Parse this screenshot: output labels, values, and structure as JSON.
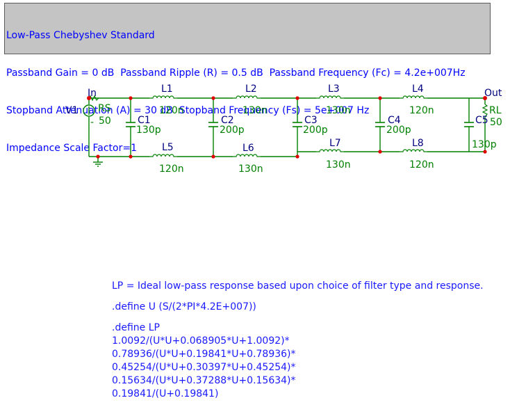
{
  "header": {
    "line1": "Low-Pass Chebyshev Standard",
    "line2": "Passband Gain = 0 dB  Passband Ripple (R) = 0.5 dB  Passband Frequency (Fc) = 4.2e+007Hz",
    "line3": "Stopband Attenuation (A) = 30 dB  Stopband Frequency (Fs) = 5e+007 Hz",
    "line4": "Impedance Scale Factor=1"
  },
  "colors": {
    "wire": "#008000",
    "component": "#008000",
    "node": "#e00000",
    "component_label": "#000080",
    "value_label": "#008000",
    "header_text": "#0000ff",
    "notes_text": "#1a1aff"
  },
  "schematic": {
    "source": {
      "name": "V1",
      "sign": "-"
    },
    "rs": {
      "name": "RS",
      "value": "50"
    },
    "rl": {
      "name": "RL",
      "value": "50"
    },
    "in_label": "In",
    "out_label": "Out",
    "inductors_top": [
      {
        "name": "L1",
        "value": "120n"
      },
      {
        "name": "L2",
        "value": "130n"
      },
      {
        "name": "L3",
        "value": "130n"
      },
      {
        "name": "L4",
        "value": "120n"
      }
    ],
    "inductors_bottom": [
      {
        "name": "L5",
        "value": "120n"
      },
      {
        "name": "L6",
        "value": "130n"
      },
      {
        "name": "L7",
        "value": "130n"
      },
      {
        "name": "L8",
        "value": "120n"
      }
    ],
    "capacitors": [
      {
        "name": "C1",
        "value": "130p"
      },
      {
        "name": "C2",
        "value": "200p"
      },
      {
        "name": "C3",
        "value": "200p"
      },
      {
        "name": "C4",
        "value": "200p"
      },
      {
        "name": "C5",
        "value": "130p"
      }
    ]
  },
  "notes": {
    "line1": "LP = Ideal low-pass response based upon choice of filter type and response.",
    "line2": ".define U (S/(2*PI*4.2E+007))",
    "line3": ".define LP",
    "line4": "1.0092/(U*U+0.068905*U+1.0092)*",
    "line5": "0.78936/(U*U+0.19841*U+0.78936)*",
    "line6": "0.45254/(U*U+0.30397*U+0.45254)*",
    "line7": "0.15634/(U*U+0.37288*U+0.15634)*",
    "line8": "0.19841/(U+0.19841)"
  }
}
